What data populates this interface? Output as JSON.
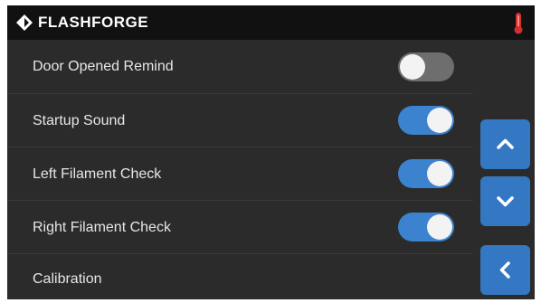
{
  "header": {
    "brand": "FLASHFORGE",
    "logo_icon": "flashforge-logo-icon",
    "status_icon": "thermometer-icon",
    "status_color": "#d32f2f"
  },
  "settings": [
    {
      "label": "Door Opened Remind",
      "toggle": "off"
    },
    {
      "label": "Startup Sound",
      "toggle": "on"
    },
    {
      "label": "Left Filament Check",
      "toggle": "on"
    },
    {
      "label": "Right Filament Check",
      "toggle": "on"
    },
    {
      "label": "Calibration"
    }
  ],
  "nav": {
    "up_icon": "chevron-up-icon",
    "down_icon": "chevron-down-icon",
    "back_icon": "chevron-left-icon"
  },
  "colors": {
    "accent": "#3c83cf",
    "button": "#3478c3",
    "background": "#2b2b2b",
    "header": "#111111"
  }
}
